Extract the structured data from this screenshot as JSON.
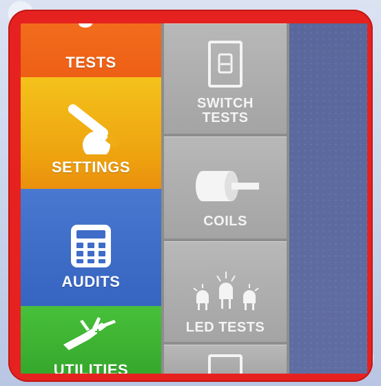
{
  "menu": {
    "left": [
      {
        "label": "TESTS",
        "icon": "tests-icon",
        "color": "#f26c1c"
      },
      {
        "label": "SETTINGS",
        "icon": "wrench-icon",
        "color": "#f0b317"
      },
      {
        "label": "AUDITS",
        "icon": "calculator-icon",
        "color": "#3f6ecb"
      },
      {
        "label": "UTILITIES",
        "icon": "multitool-icon",
        "color": "#3fb735"
      }
    ],
    "sub": [
      {
        "label_line1": "SWITCH",
        "label_line2": "TESTS",
        "icon": "switch-icon"
      },
      {
        "label": "COILS",
        "icon": "coil-icon"
      },
      {
        "label": "LED TESTS",
        "icon": "led-icon"
      },
      {
        "label": "",
        "icon": "blank-tile-icon"
      }
    ]
  },
  "colors": {
    "frame": "#e5221f",
    "right_panel": "#5d6aa0",
    "gray_tile": "#b0b0b0"
  }
}
